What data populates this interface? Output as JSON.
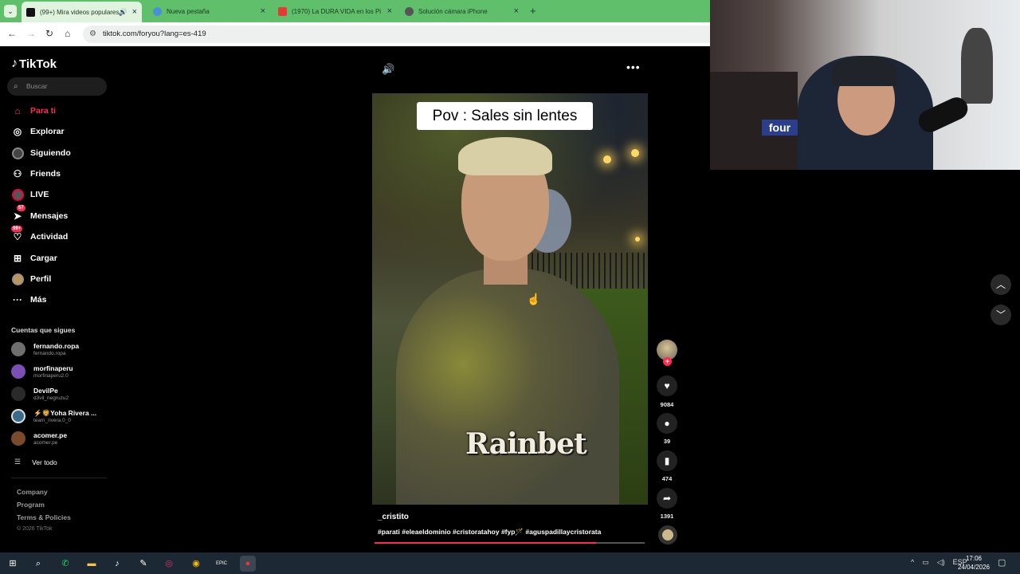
{
  "browser": {
    "tabs": [
      {
        "label": "(99+) Mira videos populares",
        "active": true,
        "favicon_color": "#111111"
      },
      {
        "label": "Nueva pestaña",
        "active": false,
        "favicon_color": "#4a90d9"
      },
      {
        "label": "(1970) La DURA VIDA en los Pi",
        "active": false,
        "favicon_color": "#e53935"
      },
      {
        "label": "Solución cámara iPhone",
        "active": false,
        "favicon_color": "#555555"
      }
    ],
    "url": "tiktok.com/foryou?lang=es-419"
  },
  "tiktok": {
    "logo": "TikTok",
    "search_placeholder": "Buscar",
    "nav": [
      {
        "label": "Para ti",
        "icon": "home-icon",
        "active": true
      },
      {
        "label": "Explorar",
        "icon": "compass-icon"
      },
      {
        "label": "Siguiendo",
        "icon": "following-icon"
      },
      {
        "label": "Friends",
        "icon": "friends-icon"
      },
      {
        "label": "LIVE",
        "icon": "live-icon"
      },
      {
        "label": "Mensajes",
        "icon": "messages-icon",
        "badge": "57"
      },
      {
        "label": "Actividad",
        "icon": "activity-icon",
        "badge": "99+"
      },
      {
        "label": "Cargar",
        "icon": "upload-icon"
      },
      {
        "label": "Perfil",
        "icon": "profile-icon"
      },
      {
        "label": "Más",
        "icon": "more-icon"
      }
    ],
    "following_title": "Cuentas que sigues",
    "following": [
      {
        "name": "fernando.ropa",
        "username": "fernando.ropa",
        "avatar_color": "#6e6e6e"
      },
      {
        "name": "morfinaperu",
        "username": "morfinaperu2.0",
        "avatar_color": "#7b4fb3"
      },
      {
        "name": "DevilPe",
        "username": "d3vil_negruzu2",
        "avatar_color": "#2a2a2a"
      },
      {
        "name": "⚡🦁Yoha Rivera ...",
        "username": "team_rivera.0_0",
        "avatar_color": "#3a6b8a"
      },
      {
        "name": "acomer.pe",
        "username": "acomer.pe",
        "avatar_color": "#7a4a2a"
      }
    ],
    "see_all": "Ver todo",
    "footer": [
      "Company",
      "Program",
      "Terms & Policies"
    ],
    "copyright": "© 2026 TikTok",
    "video": {
      "caption": "Pov : Sales sin lentes",
      "watermark": "Rainbet",
      "author": "_cristito",
      "tags": "#parati #eleaeldominio #cristoratahoy #fyp🪄 #aguspadillaycristorata",
      "progress": 0.82
    },
    "actions": {
      "likes": "9084",
      "comments": "39",
      "saves": "474",
      "shares": "1391"
    }
  },
  "taskbar": {
    "apps": [
      {
        "name": "windows-start",
        "glyph": "⊞"
      },
      {
        "name": "search",
        "glyph": "⌕"
      },
      {
        "name": "whatsapp",
        "glyph": "✆"
      },
      {
        "name": "file-explorer",
        "glyph": "▬"
      },
      {
        "name": "tiktok",
        "glyph": "♪"
      },
      {
        "name": "app-feather",
        "glyph": "✎"
      },
      {
        "name": "instagram",
        "glyph": "◎"
      },
      {
        "name": "chrome",
        "glyph": "◉"
      },
      {
        "name": "epic-games",
        "glyph": "EPIC"
      },
      {
        "name": "obs",
        "glyph": "●"
      }
    ],
    "language": "ESP",
    "time": "17:06",
    "date": "24/04/2026"
  }
}
